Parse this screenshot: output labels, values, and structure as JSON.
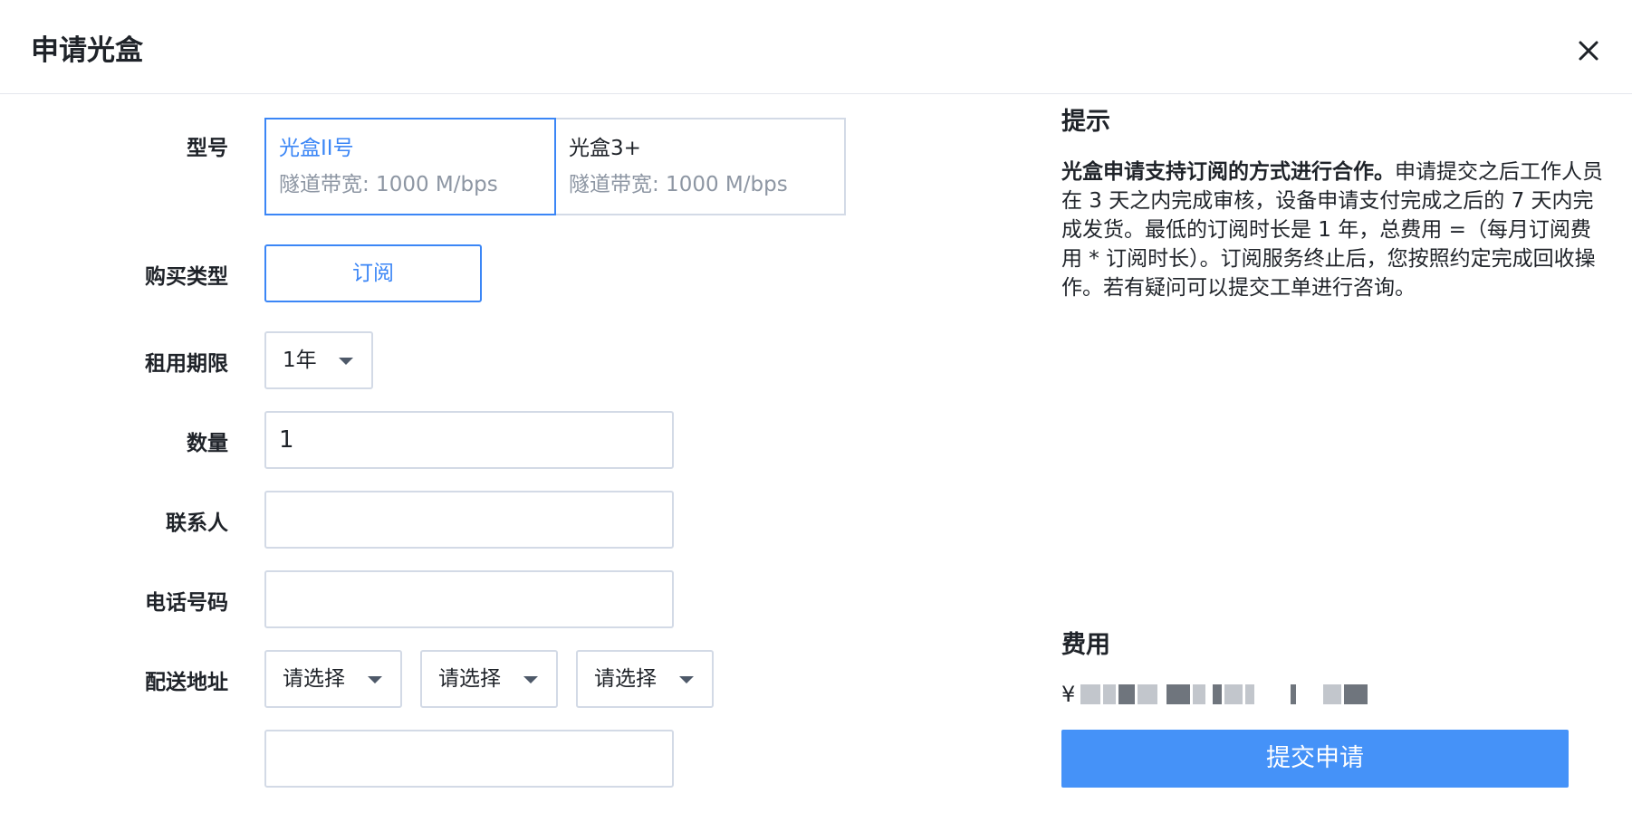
{
  "dialog": {
    "title": "申请光盒"
  },
  "form": {
    "model_label": "型号",
    "models": [
      {
        "name": "光盒II号",
        "desc": "隧道带宽: 1000 M/bps",
        "selected": true
      },
      {
        "name": "光盒3+",
        "desc": "隧道带宽: 1000 M/bps",
        "selected": false
      }
    ],
    "purchase_type_label": "购买类型",
    "purchase_type_value": "订阅",
    "term_label": "租用期限",
    "term_value": "1年",
    "quantity_label": "数量",
    "quantity_value": "1",
    "contact_label": "联系人",
    "contact_value": "",
    "phone_label": "电话号码",
    "phone_value": "",
    "address_label": "配送地址",
    "address_selects": [
      "请选择",
      "请选择",
      "请选择"
    ],
    "address_detail_value": ""
  },
  "side": {
    "tip_title": "提示",
    "tip_bold": "光盒申请支持订阅的方式进行合作。",
    "tip_text": "申请提交之后工作人员在 3 天之内完成审核，设备申请支付完成之后的 7 天内完成发货。最低的订阅时长是 1 年，总费用 =（每月订阅费用 * 订阅时长）。订阅服务终止后，您按照约定完成回收操作。若有疑问可以提交工单进行咨询。",
    "fee_title": "费用",
    "currency": "¥",
    "submit_label": "提交申请"
  },
  "colors": {
    "accent": "#3b86f6",
    "submit_bg": "#4592f8",
    "border": "#d3dae6"
  },
  "icons": {
    "close": "close-icon",
    "dropdown": "caret-down-icon"
  }
}
